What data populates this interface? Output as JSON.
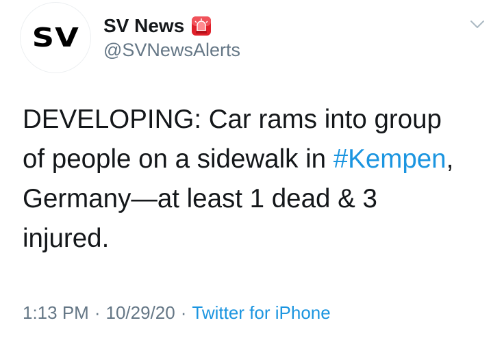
{
  "tweet": {
    "avatar_text": "SV",
    "display_name": "SV News",
    "handle": "@SVNewsAlerts",
    "badge_icon": "siren-icon",
    "menu_icon": "chevron-down-icon",
    "body_lines": [
      {
        "before": "DEVELOPING: Car rams into group",
        "hashtag": "",
        "after": ""
      },
      {
        "before": "of people on a sidewalk in ",
        "hashtag": "#Kempen",
        "after": ","
      },
      {
        "before": "Germany—at least 1 dead & 3",
        "hashtag": "",
        "after": ""
      },
      {
        "before": "injured.",
        "hashtag": "",
        "after": ""
      }
    ],
    "time": "1:13 PM",
    "date": "10/29/20",
    "separator": "·",
    "source": "Twitter for iPhone"
  },
  "colors": {
    "link": "#1b95e0",
    "secondary_text": "#657786",
    "primary_text": "#14171a",
    "siren_red": "#e0202a"
  }
}
